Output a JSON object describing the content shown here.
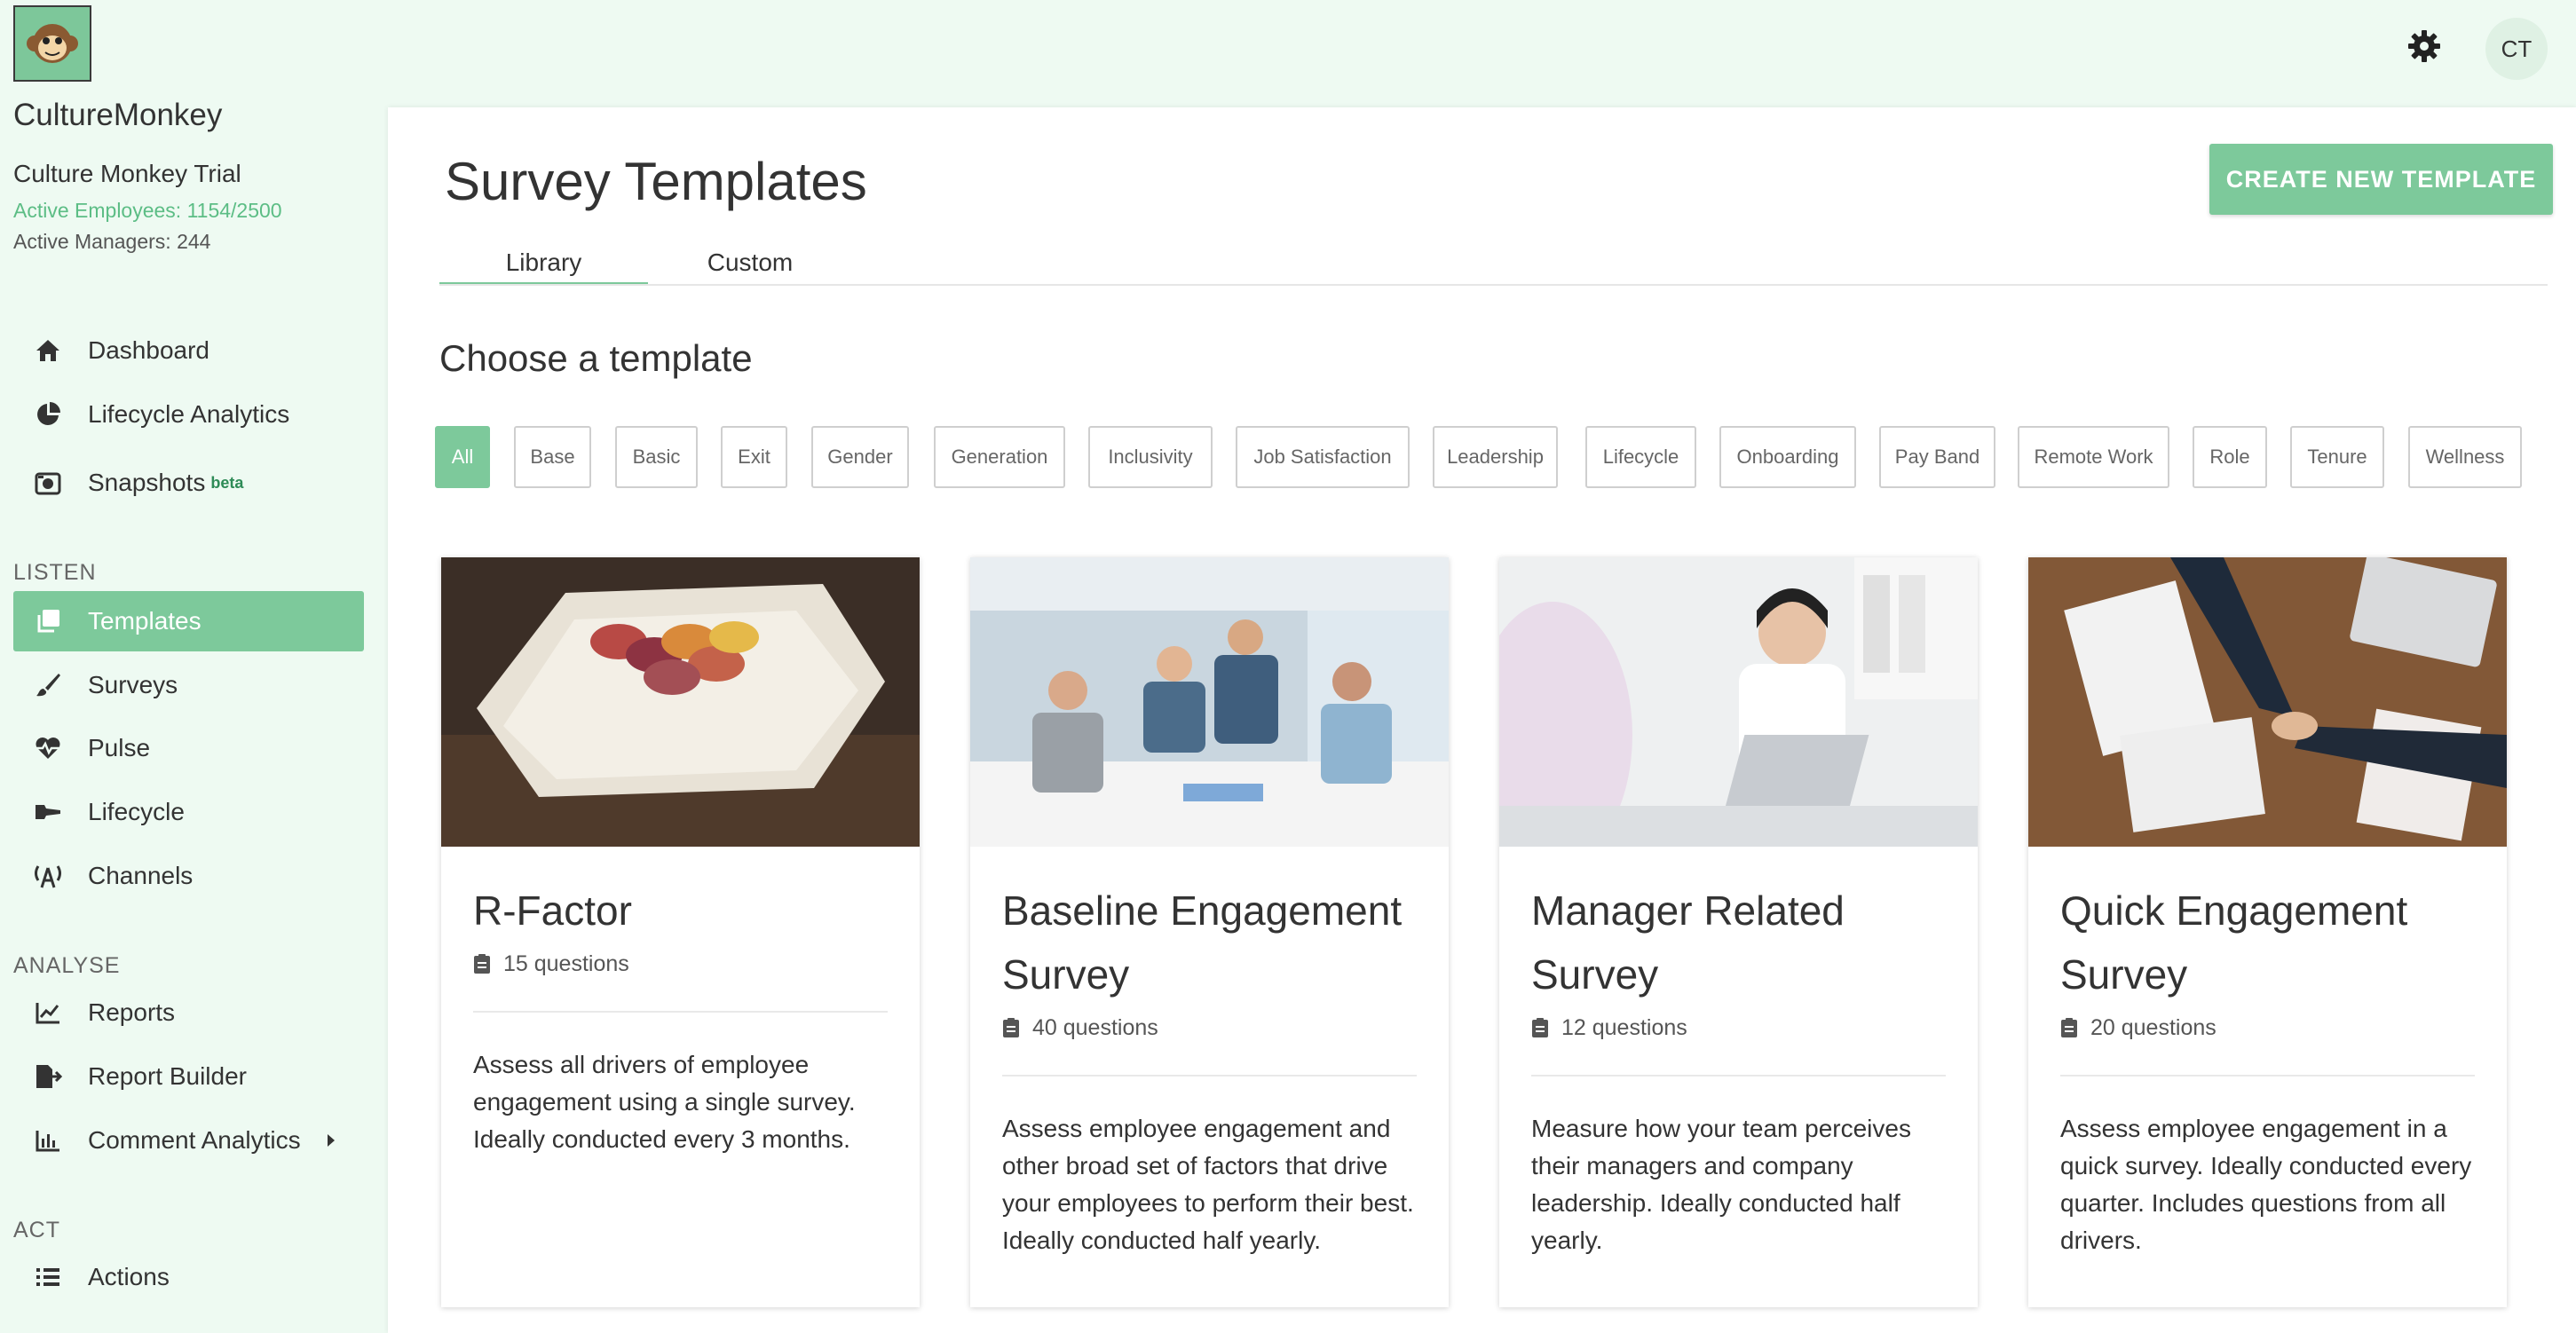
{
  "app": {
    "name": "CultureMonkey",
    "org": "Culture Monkey Trial",
    "active_employees": "Active Employees: 1154/2500",
    "active_managers": "Active Managers: 244",
    "user_initials": "CT"
  },
  "sidebar": {
    "top_items": [
      {
        "label": "Dashboard",
        "icon": "home-icon"
      },
      {
        "label": "Lifecycle Analytics",
        "icon": "pie-chart-icon"
      },
      {
        "label": "Snapshots",
        "badge": "beta",
        "icon": "camera-icon"
      }
    ],
    "listen_label": "LISTEN",
    "listen_items": [
      {
        "label": "Templates",
        "icon": "copy-icon",
        "active": true
      },
      {
        "label": "Surveys",
        "icon": "brush-icon"
      },
      {
        "label": "Pulse",
        "icon": "heartbeat-icon"
      },
      {
        "label": "Lifecycle",
        "icon": "key-icon"
      },
      {
        "label": "Channels",
        "icon": "broadcast-icon"
      }
    ],
    "analyse_label": "ANALYSE",
    "analyse_items": [
      {
        "label": "Reports",
        "icon": "line-chart-icon"
      },
      {
        "label": "Report Builder",
        "icon": "file-export-icon"
      },
      {
        "label": "Comment Analytics",
        "icon": "bar-chart-icon"
      }
    ],
    "act_label": "ACT",
    "act_items": [
      {
        "label": "Actions",
        "icon": "list-icon"
      }
    ]
  },
  "main": {
    "title": "Survey Templates",
    "create_button": "CREATE NEW TEMPLATE",
    "tabs": [
      {
        "label": "Library",
        "active": true
      },
      {
        "label": "Custom",
        "active": false
      }
    ],
    "section_title": "Choose a template",
    "filters": [
      "All",
      "Base",
      "Basic",
      "Exit",
      "Gender",
      "Generation",
      "Inclusivity",
      "Job Satisfaction",
      "Leadership",
      "Lifecycle",
      "Onboarding",
      "Pay Band",
      "Remote Work",
      "Role",
      "Tenure",
      "Wellness"
    ],
    "active_filter": "All",
    "cards": [
      {
        "title": "R-Factor",
        "questions": "15 questions",
        "description": "Assess all drivers of employee engagement using a single survey. Ideally conducted every 3 months."
      },
      {
        "title": "Baseline Engagement Survey",
        "questions": "40 questions",
        "description": "Assess employee engagement and other broad set of factors that drive your employees to perform their best. Ideally conducted half yearly."
      },
      {
        "title": "Manager Related Survey",
        "questions": "12 questions",
        "description": "Measure how your team perceives their managers and company leadership. Ideally conducted half yearly."
      },
      {
        "title": "Quick Engagement Survey",
        "questions": "20 questions",
        "description": "Assess employee engagement in a quick survey. Ideally conducted every quarter. Includes questions from all drivers."
      }
    ]
  },
  "colors": {
    "accent": "#7dc99b",
    "sidebar_bg": "#eefaf2",
    "emp_text": "#5cbd85"
  }
}
